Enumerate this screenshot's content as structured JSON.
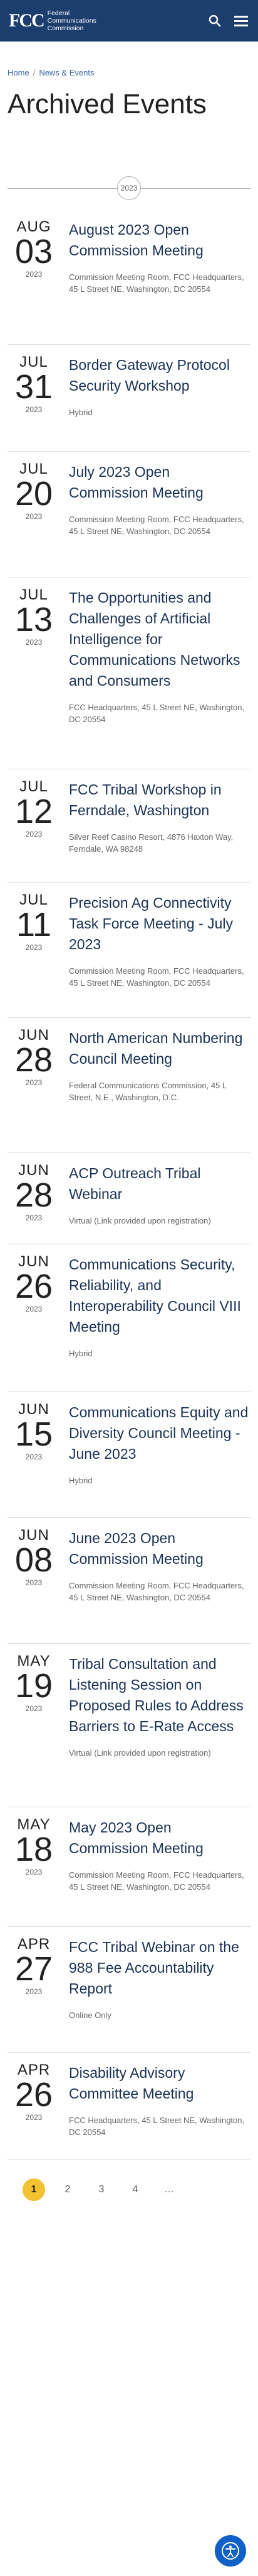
{
  "header": {
    "logo_mark": "FCC",
    "logo_line1": "Federal",
    "logo_line2": "Communications",
    "logo_line3": "Commission"
  },
  "breadcrumb": [
    "Home",
    "News & Events"
  ],
  "page_title": "Archived Events",
  "year_marker": "2023",
  "events": [
    {
      "month": "AUG",
      "day": "03",
      "year": "2023",
      "title": "August 2023 Open Commission Meeting",
      "location": "Commission Meeting Room, FCC Headquarters, 45 L Street NE, Washington, DC 20554"
    },
    {
      "month": "JUL",
      "day": "31",
      "year": "2023",
      "title": "Border Gateway Protocol Security Workshop",
      "location": "Hybrid"
    },
    {
      "month": "JUL",
      "day": "20",
      "year": "2023",
      "title": "July 2023 Open Commission Meeting",
      "location": "Commission Meeting Room, FCC Headquarters, 45 L Street NE, Washington, DC 20554"
    },
    {
      "month": "JUL",
      "day": "13",
      "year": "2023",
      "title": "The Opportunities and Challenges of Artificial Intelligence for Communications Networks and Consumers",
      "location": "FCC Headquarters, 45 L Street NE, Washington, DC 20554"
    },
    {
      "month": "JUL",
      "day": "12",
      "year": "2023",
      "title": "FCC Tribal Workshop in Ferndale, Washington",
      "location": "Silver Reef Casino Resort, 4876 Haxton Way, Ferndale, WA 98248"
    },
    {
      "month": "JUL",
      "day": "11",
      "year": "2023",
      "title": "Precision Ag Connectivity Task Force Meeting - July 2023",
      "location": "Commission Meeting Room, FCC Headquarters, 45 L Street NE, Washington, DC 20554"
    },
    {
      "month": "JUN",
      "day": "28",
      "year": "2023",
      "title": "North American Numbering Council Meeting",
      "location": "Federal Communications Commission, 45 L Street, N.E., Washington, D.C."
    },
    {
      "month": "JUN",
      "day": "28",
      "year": "2023",
      "title": "ACP Outreach Tribal Webinar",
      "location": "Virtual (Link provided upon registration)"
    },
    {
      "month": "JUN",
      "day": "26",
      "year": "2023",
      "title": "Communications Security, Reliability, and Interoperability Council VIII Meeting",
      "location": "Hybrid"
    },
    {
      "month": "JUN",
      "day": "15",
      "year": "2023",
      "title": "Communications Equity and Diversity Council Meeting - June 2023",
      "location": "Hybrid"
    },
    {
      "month": "JUN",
      "day": "08",
      "year": "2023",
      "title": "June 2023 Open Commission Meeting",
      "location": "Commission Meeting Room, FCC Headquarters, 45 L Street NE, Washington, DC 20554"
    },
    {
      "month": "MAY",
      "day": "19",
      "year": "2023",
      "title": "Tribal Consultation and Listening Session on Proposed Rules to Address Barriers to E-Rate Access",
      "location": "Virtual (Link provided upon registration)"
    },
    {
      "month": "MAY",
      "day": "18",
      "year": "2023",
      "title": "May 2023 Open Commission Meeting",
      "location": "Commission Meeting Room, FCC Headquarters, 45 L Street NE, Washington, DC 20554"
    },
    {
      "month": "APR",
      "day": "27",
      "year": "2023",
      "title": "FCC Tribal Webinar on the 988 Fee Accountability Report",
      "location": "Online Only"
    },
    {
      "month": "APR",
      "day": "26",
      "year": "2023",
      "title": "Disability Advisory Committee Meeting",
      "location": "FCC Headquarters, 45 L Street NE, Washington, DC 20554"
    }
  ],
  "pagination": [
    "1",
    "2",
    "3",
    "4",
    "…"
  ]
}
